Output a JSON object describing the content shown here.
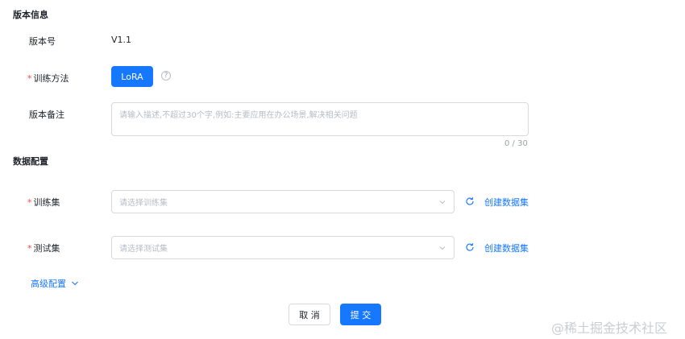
{
  "version_section": {
    "title": "版本信息",
    "version_label": "版本号",
    "version_value": "V1.1",
    "method_label": "训练方法",
    "method_button": "LoRA",
    "help_icon": "question-circle-icon",
    "note_label": "版本备注",
    "note_placeholder": "请输入描述,不超过30个字,例如:主要应用在办公场景,解决相关问题",
    "note_counter": "0 / 30"
  },
  "data_section": {
    "title": "数据配置",
    "train_label": "训练集",
    "train_placeholder": "请选择训练集",
    "train_create": "创建数据集",
    "test_label": "测试集",
    "test_placeholder": "请选择测试集",
    "test_create": "创建数据集",
    "refresh_icon": "refresh-icon",
    "chevron_icon": "chevron-down-icon"
  },
  "advanced": {
    "label": "高级配置"
  },
  "actions": {
    "cancel": "取 消",
    "submit": "提 交"
  },
  "watermark": "@稀土掘金技术社区",
  "colors": {
    "primary": "#1677ff",
    "required": "#f54a45",
    "border": "#d9d9d9"
  }
}
